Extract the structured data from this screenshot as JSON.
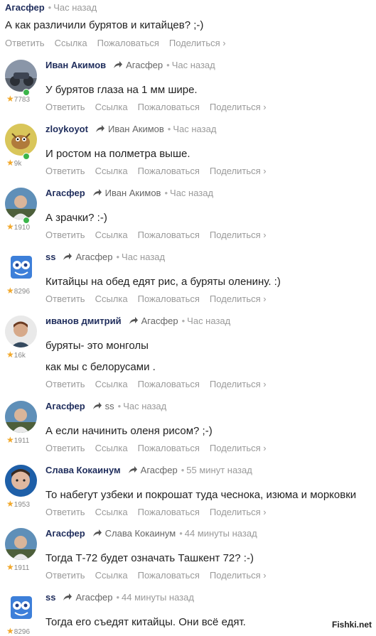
{
  "actions": {
    "reply": "Ответить",
    "link": "Ссылка",
    "report": "Пожаловаться",
    "share": "Поделиться ›"
  },
  "watermark": "Fishki.net",
  "top": {
    "author": "Агасфер",
    "time": "Час назад",
    "text": "А как различили бурятов и китайцев? ;-)"
  },
  "comments": [
    {
      "author": "Иван Акимов",
      "reply_to": "Агасфер",
      "time": "Час назад",
      "rating": "7783",
      "lines": [
        "У бурятов глаза на 1 мм шире."
      ],
      "avatar": "avatar-moto"
    },
    {
      "author": "zloykoyot",
      "reply_to": "Иван Акимов",
      "time": "Час назад",
      "rating": "9k",
      "lines": [
        "И ростом на полметра выше."
      ],
      "avatar": "avatar-cartoon"
    },
    {
      "author": "Агасфер",
      "reply_to": "Иван Акимов",
      "time": "Час назад",
      "rating": "1910",
      "lines": [
        "А зрачки? :-)"
      ],
      "avatar": "avatar-man"
    },
    {
      "author": "ss",
      "reply_to": "Агасфер",
      "time": "Час назад",
      "rating": "8296",
      "lines": [
        "Китайцы на обед едят рис, а буряты оленину. :)"
      ],
      "avatar": "avatar-sponge"
    },
    {
      "author": "иванов дмитрий",
      "reply_to": "Агасфер",
      "time": "Час назад",
      "rating": "16k",
      "lines": [
        "буряты- это монголы",
        "как мы с белорусами ."
      ],
      "avatar": "avatar-dexter"
    },
    {
      "author": "Агасфер",
      "reply_to": "ss",
      "time": "Час назад",
      "rating": "1911",
      "lines": [
        "А если начинить оленя рисом? ;-)"
      ],
      "avatar": "avatar-man"
    },
    {
      "author": "Слава Кокаинум",
      "reply_to": "Агасфер",
      "time": "55 минут назад",
      "rating": "1953",
      "lines": [
        "То набегут узбеки и покрошат туда чеснока, изюма и морковки"
      ],
      "avatar": "avatar-face"
    },
    {
      "author": "Агасфер",
      "reply_to": "Слава Кокаинум",
      "time": "44 минуты назад",
      "rating": "1911",
      "lines": [
        "Тогда Т-72 будет означать Ташкент 72? :-)"
      ],
      "avatar": "avatar-man"
    },
    {
      "author": "ss",
      "reply_to": "Агасфер",
      "time": "44 минуты назад",
      "rating": "8296",
      "lines": [
        "Тогда его съедят китайцы. Они всё едят."
      ],
      "avatar": "avatar-sponge"
    }
  ]
}
